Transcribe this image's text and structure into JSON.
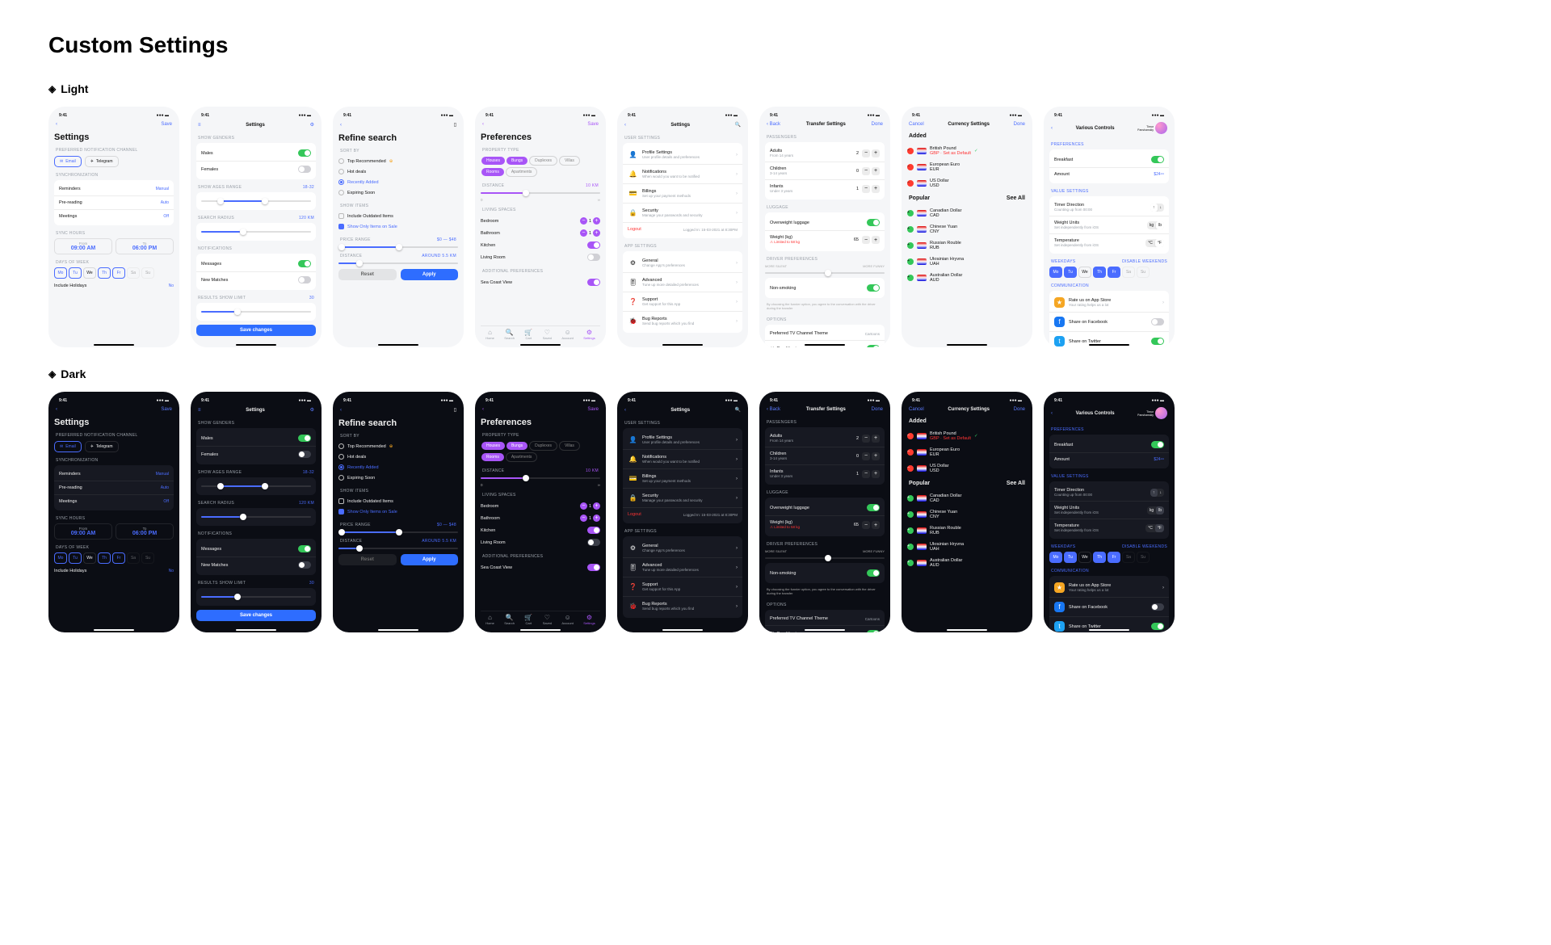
{
  "page_title": "Custom Settings",
  "themes": {
    "light": "Light",
    "dark": "Dark"
  },
  "status_time": "9:41",
  "screens": {
    "s1": {
      "save": "Save",
      "title": "Settings",
      "pref_channel": "Preferred Notification Channel",
      "email": "Email",
      "telegram": "Telegram",
      "sync": "Synchronization",
      "reminders": "Reminders",
      "reminders_v": "Manual",
      "prereading": "Pre-reading",
      "prereading_v": "Auto",
      "meetings": "Meetings",
      "meetings_v": "Off",
      "sync_hours": "Sync Hours",
      "from_l": "From",
      "from_v": "09:00 AM",
      "to_l": "To",
      "to_v": "06:00 PM",
      "dow": "Days of Week",
      "days": [
        "Mo",
        "Tu",
        "We",
        "Th",
        "Fr",
        "Sa",
        "Su"
      ],
      "holidays": "Include Holidays",
      "holidays_v": "No"
    },
    "s2": {
      "title": "Settings",
      "show_genders": "SHOW GENDERS",
      "males": "Males",
      "females": "Females",
      "ages": "SHOW AGES RANGE",
      "ages_v": "18-32",
      "radius": "SEARCH RADIUS",
      "radius_v": "120 km",
      "notif": "NOTIFICATIONS",
      "messages": "Messages",
      "new_matches": "New Matches",
      "limit": "RESULTS SHOW LIMIT",
      "limit_v": "30",
      "save": "Save changes"
    },
    "s3": {
      "title": "Refine search",
      "sort": "Sort by",
      "opt1": "Top Recommended",
      "opt2": "Hot deals",
      "opt3": "Recently Added",
      "opt4": "Expiring Soon",
      "show_items": "Show Items",
      "outdated": "Include Outdated Items",
      "onsale": "Show Only Items on Sale",
      "price": "Price Range",
      "price_v": "$0 — $48",
      "distance": "Distance",
      "distance_v": "Around 5.5 km",
      "reset": "Reset",
      "apply": "Apply"
    },
    "s4": {
      "save": "Save",
      "title": "Preferences",
      "ptype": "Property Type",
      "chips": [
        "Houses",
        "Bungs",
        "Duplexes",
        "Villas",
        "Rooms",
        "Apartments"
      ],
      "distance": "Distance",
      "distance_v": "10 km",
      "min": "0",
      "max": "∞",
      "living": "Living Spaces",
      "bedroom": "Bedroom",
      "bedroom_v": "1",
      "bathroom": "Bathroom",
      "bathroom_v": "1",
      "kitchen": "Kitchen",
      "living_room": "Living Room",
      "addl": "Additional Preferences",
      "seacoast": "Sea Coast View",
      "tabs": [
        "Home",
        "Search",
        "Cart",
        "Saved",
        "Account",
        "Settings"
      ]
    },
    "s5": {
      "title": "Settings",
      "user_settings": "USER SETTINGS",
      "profile": "Profile Settings",
      "profile_s": "User profile details and preferences",
      "notif": "Notifications",
      "notif_s": "When would you want to be notified",
      "billings": "Billings",
      "billings_s": "Set up your payment methods",
      "security": "Security",
      "security_s": "Manage your passwords and security",
      "logout": "Logout",
      "logged": "Logged In: 15-03-2021 at 8:30PM",
      "app_settings": "APP SETTINGS",
      "general": "General",
      "general_s": "Change App's preferences",
      "advanced": "Advanced",
      "advanced_s": "Tune up more detailed preferences",
      "support": "Support",
      "support_s": "Get support for this App",
      "bugs": "Bug Reports",
      "bugs_s": "Send bug reports which you find"
    },
    "s6": {
      "back": "Back",
      "title": "Transfer Settings",
      "done": "Done",
      "pax": "PASSENGERS",
      "adults": "Adults",
      "adults_s": "From 14 years",
      "adults_v": "2",
      "children": "Children",
      "children_s": "3-14 years",
      "children_v": "0",
      "infants": "Infants",
      "infants_s": "Under 3 years",
      "infants_v": "1",
      "luggage": "LUGGAGE",
      "overweight": "Overweight luggage",
      "weight": "Weight (kg)",
      "weight_v": "65",
      "weight_warn": "⚠ Limited to 58 kg",
      "driver": "DRIVER PREFERENCES",
      "silent": "MORE SILENT",
      "funny": "MORE FUNNY",
      "nonsmoking": "Non-smoking",
      "choose_note": "By choosing the funnier option, you agree to the conversation with the driver during the transfer",
      "options": "OPTIONS",
      "tv": "Preferred TV Channel Theme",
      "tv_v": "Cartoons",
      "ac": "Air Conditioning"
    },
    "s7": {
      "cancel": "Cancel",
      "title": "Currency Settings",
      "done": "Done",
      "added": "Added",
      "gbp": "British Pound",
      "gbp_s": "GBP · Set as Default",
      "eur": "European Euro",
      "eur_s": "EUR",
      "usd": "US Dollar",
      "usd_s": "USD",
      "popular": "Popular",
      "see_all": "See All",
      "cad": "Canadian Dollar",
      "cad_s": "CAD",
      "cny": "Chinese Yuan",
      "cny_s": "CNY",
      "rub": "Russian Rouble",
      "rub_s": "RUB",
      "uah": "Ukrainian Hryvna",
      "uah_s": "UAH",
      "aud": "Australian Dollar",
      "aud_s": "AUD"
    },
    "s8": {
      "title": "Various Controls",
      "user": "Timur\nPanshanskiy",
      "prefs": "PREFERENCES",
      "breakfast": "Breakfast",
      "amount": "Amount",
      "amount_v": "$24⁹⁹",
      "vals": "VALUE SETTINGS",
      "timer": "Timer Direction",
      "timer_s": "Counting up from 00:00",
      "units": "Weight Units",
      "units_s": "Set independently from iOS",
      "kg": "kg",
      "lb": "lb",
      "temp": "Temperature",
      "temp_s": "Set independently from iOS",
      "c": "°C",
      "f": "°F",
      "weekdays": "WEEKDAYS",
      "disable_wk": "DISABLE WEEKENDS",
      "days": [
        "Mo",
        "Tu",
        "We",
        "Th",
        "Fr",
        "Sa",
        "Su"
      ],
      "comm": "COMMUNICATION",
      "rate": "Rate us on App Store",
      "rate_s": "Your rating helps us a lot",
      "fb": "Share on Facebook",
      "tw": "Share on Twitter"
    }
  }
}
